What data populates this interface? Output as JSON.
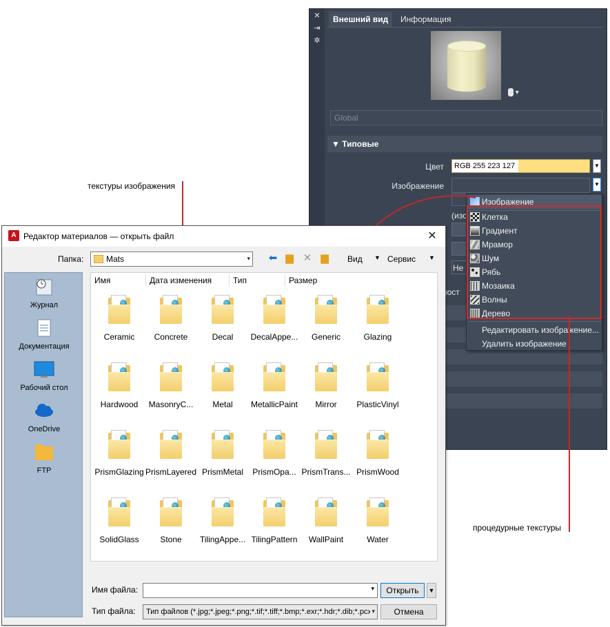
{
  "panel": {
    "tabs": [
      "Внешний вид",
      "Информация"
    ],
    "name_field_placeholder": "Global",
    "section_title": "Типовые",
    "color_label": "Цвет",
    "color_value": "RGB 255 223 127",
    "image_label": "Изображение",
    "partial_label_1": "(изо",
    "partial_label_2": "Не",
    "partial_label_3": "ност",
    "swatch_color": "#ffdf7f"
  },
  "dropdown": {
    "items": [
      {
        "label": "Изображение",
        "icon": "image-icon"
      },
      {
        "label": "Клетка",
        "icon": "checker-icon"
      },
      {
        "label": "Градиент",
        "icon": "gradient-icon"
      },
      {
        "label": "Мрамор",
        "icon": "marble-icon"
      },
      {
        "label": "Шум",
        "icon": "noise-icon"
      },
      {
        "label": "Рябь",
        "icon": "speckle-icon"
      },
      {
        "label": "Мозаика",
        "icon": "tiles-icon"
      },
      {
        "label": "Волны",
        "icon": "waves-icon"
      },
      {
        "label": "Дерево",
        "icon": "wood-icon"
      }
    ],
    "edit_image": "Редактировать изображение...",
    "delete_image": "Удалить изображение"
  },
  "annotations": {
    "image_textures": "текстуры изображения",
    "procedural_textures": "процедурные текстуры",
    "line_color": "#c0282a"
  },
  "dialog": {
    "title": "Редактор материалов — открыть файл",
    "folder_label": "Папка:",
    "folder_value": "Mats",
    "view_label": "Вид",
    "service_label": "Сервис",
    "places": [
      "Журнал",
      "Документация",
      "Рабочий стол",
      "OneDrive",
      "FTP"
    ],
    "columns": [
      "Имя",
      "Дата изменения",
      "Тип",
      "Размер"
    ],
    "files": [
      "Ceramic",
      "Concrete",
      "Decal",
      "DecalAppe...",
      "Generic",
      "Glazing",
      "Hardwood",
      "MasonryC...",
      "Metal",
      "MetallicPaint",
      "Mirror",
      "PlasticVinyl",
      "PrismGlazing",
      "PrismLayered",
      "PrismMetal",
      "PrismOpa...",
      "PrismTrans...",
      "PrismWood",
      "SolidGlass",
      "Stone",
      "TilingAppe...",
      "TilingPattern",
      "WallPaint",
      "Water"
    ],
    "filename_label": "Имя файла:",
    "filename_value": "",
    "filetype_label": "Тип файла:",
    "filetype_value": "Тип файлов  (*.jpg;*.jpeg;*.png;*.tif;*.tiff;*.bmp;*.exr;*.hdr;*.dib;*.pcx",
    "open_button": "Открыть",
    "cancel_button": "Отмена"
  }
}
